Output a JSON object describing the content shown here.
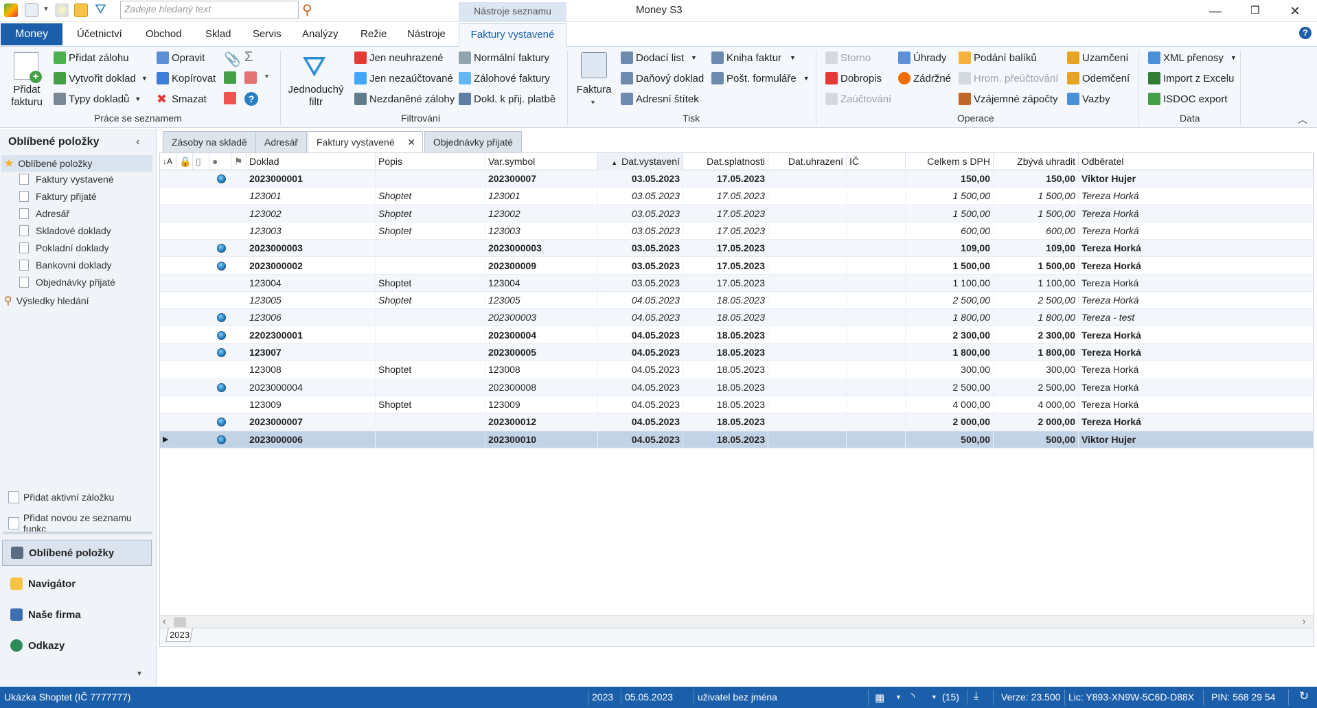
{
  "search": {
    "placeholder": "Zadejte hledaný text"
  },
  "context_tab": "Nástroje seznamu",
  "app_title": "Money S3",
  "menu": [
    "Money",
    "Účetnictví",
    "Obchod",
    "Sklad",
    "Servis",
    "Analýzy",
    "Režie",
    "Nástroje",
    "Faktury vystavené"
  ],
  "ribbon": {
    "prace": {
      "pridat_fakturu": "Přidat fakturu",
      "pridat_zalohu": "Přidat zálohu",
      "vytvorit_doklad": "Vytvořit doklad",
      "typy_dokladu": "Typy dokladů",
      "opravit": "Opravit",
      "kopirovat": "Kopírovat",
      "smazat": "Smazat",
      "label": "Práce se seznamem"
    },
    "filtrovani": {
      "jednoduchy_filtr": "Jednoduchý filtr",
      "jen_neuhrazene": "Jen neuhrazené",
      "jen_nezauctovane": "Jen nezaúčtované",
      "nezdanene_zalohy": "Nezdaněné zálohy",
      "normalni_faktury": "Normální faktury",
      "zalohove_faktury": "Zálohové faktury",
      "dokl_k_prij_platbe": "Dokl. k přij. platbě",
      "label": "Filtrování"
    },
    "tisk": {
      "faktura": "Faktura",
      "dodaci_list": "Dodací list",
      "danovy_doklad": "Daňový doklad",
      "adresni_stitek": "Adresní štítek",
      "kniha_faktur": "Kniha faktur",
      "post_formulare": "Pošt. formuláře",
      "label": "Tisk"
    },
    "operace": {
      "storno": "Storno",
      "dobropis": "Dobropis",
      "zauctovani": "Zaúčtování",
      "uhrady": "Úhrady",
      "zadrzne": "Zádržné",
      "podani_baliku": "Podání balíků",
      "hrom_preuctovani": "Hrom. přeúčtování",
      "vzajemne_zapocty": "Vzájemné zápočty",
      "uzamceni": "Uzamčení",
      "odemceni": "Odemčení",
      "vazby": "Vazby",
      "label": "Operace"
    },
    "data": {
      "xml_prenosy": "XML přenosy",
      "import_z_excelu": "Import z Excelu",
      "isdoc_export": "ISDOC export",
      "label": "Data"
    }
  },
  "sidebar": {
    "header": "Oblíbené položky",
    "items": [
      "Oblíbené položky",
      "Faktury vystavené",
      "Faktury přijaté",
      "Adresář",
      "Skladové doklady",
      "Pokladní doklady",
      "Bankovní doklady",
      "Objednávky přijaté",
      "Výsledky hledání"
    ],
    "actions": [
      "Přidat aktivní záložku",
      "Přidat novou ze seznamu funkc"
    ],
    "bottom": [
      "Oblíbené položky",
      "Navigátor",
      "Naše firma",
      "Odkazy"
    ]
  },
  "tabs": [
    "Zásoby na skladě",
    "Adresář",
    "Faktury vystavené",
    "Objednávky přijaté"
  ],
  "grid": {
    "columns": [
      "Doklad",
      "Popis",
      "Var.symbol",
      "Dat.vystavení",
      "Dat.splatnosti",
      "Dat.uhrazení",
      "IČ",
      "Celkem s DPH",
      "Zbývá uhradit",
      "Odběratel"
    ],
    "rows": [
      {
        "doklad": "2023000001",
        "popis": "",
        "vs": "202300007",
        "vyst": "03.05.2023",
        "spl": "17.05.2023",
        "celkem": "150,00",
        "zbyva": "150,00",
        "odb": "Viktor Hujer",
        "style": "bold",
        "globe": true
      },
      {
        "doklad": "123001",
        "popis": "Shoptet",
        "vs": "123001",
        "vyst": "03.05.2023",
        "spl": "17.05.2023",
        "celkem": "1 500,00",
        "zbyva": "1 500,00",
        "odb": "Tereza Horká",
        "style": "italic",
        "globe": false
      },
      {
        "doklad": "123002",
        "popis": "Shoptet",
        "vs": "123002",
        "vyst": "03.05.2023",
        "spl": "17.05.2023",
        "celkem": "1 500,00",
        "zbyva": "1 500,00",
        "odb": "Tereza Horká",
        "style": "italic",
        "globe": false
      },
      {
        "doklad": "123003",
        "popis": "Shoptet",
        "vs": "123003",
        "vyst": "03.05.2023",
        "spl": "17.05.2023",
        "celkem": "600,00",
        "zbyva": "600,00",
        "odb": "Tereza Horká",
        "style": "italic",
        "globe": false
      },
      {
        "doklad": "2023000003",
        "popis": "",
        "vs": "2023000003",
        "vyst": "03.05.2023",
        "spl": "17.05.2023",
        "celkem": "109,00",
        "zbyva": "109,00",
        "odb": "Tereza Horká",
        "style": "bold",
        "globe": true
      },
      {
        "doklad": "2023000002",
        "popis": "",
        "vs": "202300009",
        "vyst": "03.05.2023",
        "spl": "17.05.2023",
        "celkem": "1 500,00",
        "zbyva": "1 500,00",
        "odb": "Tereza Horká",
        "style": "bold",
        "globe": true
      },
      {
        "doklad": "123004",
        "popis": "Shoptet",
        "vs": "123004",
        "vyst": "03.05.2023",
        "spl": "17.05.2023",
        "celkem": "1 100,00",
        "zbyva": "1 100,00",
        "odb": "Tereza Horká",
        "style": "normal",
        "globe": false
      },
      {
        "doklad": "123005",
        "popis": "Shoptet",
        "vs": "123005",
        "vyst": "04.05.2023",
        "spl": "18.05.2023",
        "celkem": "2 500,00",
        "zbyva": "2 500,00",
        "odb": "Tereza Horká",
        "style": "italic",
        "globe": false
      },
      {
        "doklad": "123006",
        "popis": "",
        "vs": "202300003",
        "vyst": "04.05.2023",
        "spl": "18.05.2023",
        "celkem": "1 800,00",
        "zbyva": "1 800,00",
        "odb": "Tereza - test",
        "style": "italic",
        "globe": true
      },
      {
        "doklad": "2202300001",
        "popis": "",
        "vs": "202300004",
        "vyst": "04.05.2023",
        "spl": "18.05.2023",
        "celkem": "2 300,00",
        "zbyva": "2 300,00",
        "odb": "Tereza Horká",
        "style": "bold",
        "globe": true
      },
      {
        "doklad": "123007",
        "popis": "",
        "vs": "202300005",
        "vyst": "04.05.2023",
        "spl": "18.05.2023",
        "celkem": "1 800,00",
        "zbyva": "1 800,00",
        "odb": "Tereza Horká",
        "style": "bold",
        "globe": true
      },
      {
        "doklad": "123008",
        "popis": "Shoptet",
        "vs": "123008",
        "vyst": "04.05.2023",
        "spl": "18.05.2023",
        "celkem": "300,00",
        "zbyva": "300,00",
        "odb": "Tereza Horká",
        "style": "normal",
        "globe": false
      },
      {
        "doklad": "2023000004",
        "popis": "",
        "vs": "202300008",
        "vyst": "04.05.2023",
        "spl": "18.05.2023",
        "celkem": "2 500,00",
        "zbyva": "2 500,00",
        "odb": "Tereza Horká",
        "style": "normal",
        "globe": true
      },
      {
        "doklad": "123009",
        "popis": "Shoptet",
        "vs": "123009",
        "vyst": "04.05.2023",
        "spl": "18.05.2023",
        "celkem": "4 000,00",
        "zbyva": "4 000,00",
        "odb": "Tereza Horká",
        "style": "normal",
        "globe": false
      },
      {
        "doklad": "2023000007",
        "popis": "",
        "vs": "202300012",
        "vyst": "04.05.2023",
        "spl": "18.05.2023",
        "celkem": "2 000,00",
        "zbyva": "2 000,00",
        "odb": "Tereza Horká",
        "style": "bold",
        "globe": true
      },
      {
        "doklad": "2023000006",
        "popis": "",
        "vs": "202300010",
        "vyst": "04.05.2023",
        "spl": "18.05.2023",
        "celkem": "500,00",
        "zbyva": "500,00",
        "odb": "Viktor Hujer",
        "style": "bold",
        "globe": true,
        "selected": true
      }
    ]
  },
  "year_tab": "2023",
  "status": {
    "firma": "Ukázka Shoptet (IČ 7777777)",
    "rok": "2023",
    "datum": "05.05.2023",
    "uzivatel": "uživatel bez jména",
    "count": "(15)",
    "verze": "Verze: 23.500",
    "lic": "Lic: Y893-XN9W-5C6D-D88X",
    "pin": "PIN: 568 29 54"
  },
  "colors": {
    "accent": "#1b5faa",
    "ribbon_bg": "#f4f7fb",
    "selected_row": "#c3d3e6"
  }
}
